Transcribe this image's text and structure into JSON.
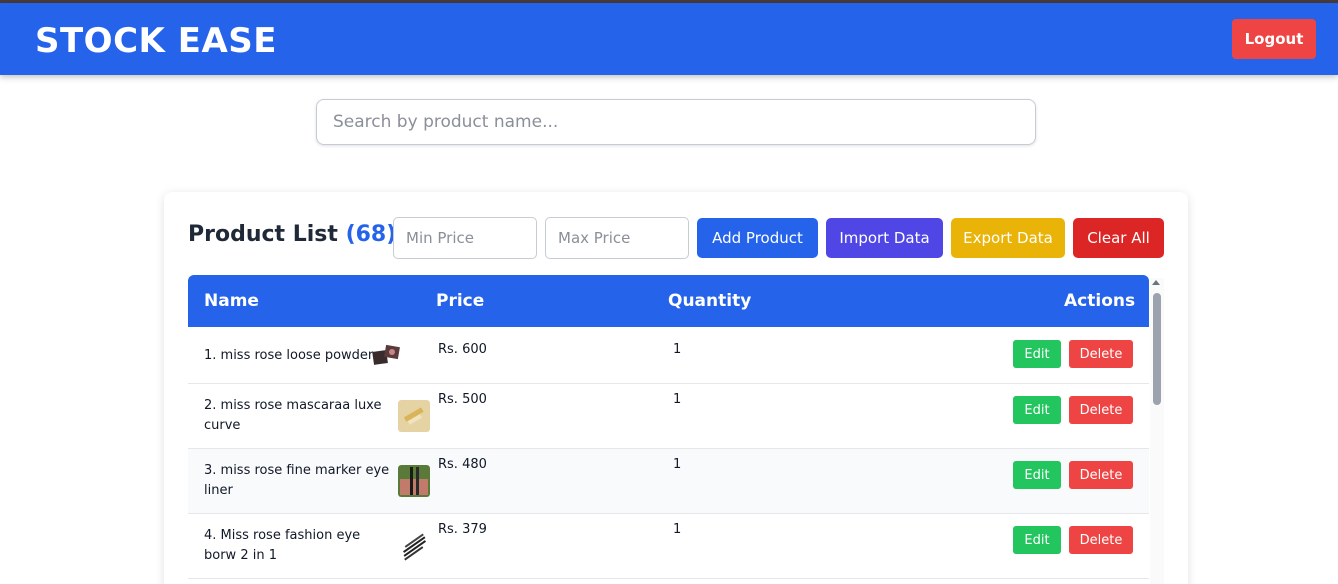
{
  "header": {
    "brand": "STOCK EASE",
    "logout_label": "Logout"
  },
  "search": {
    "placeholder": "Search by product name..."
  },
  "product_list": {
    "title": "Product List",
    "count": "(68)",
    "min_price_placeholder": "Min Price",
    "max_price_placeholder": "Max Price",
    "add_label": "Add Product",
    "import_label": "Import Data",
    "export_label": "Export Data",
    "clear_label": "Clear All"
  },
  "table": {
    "columns": [
      "Name",
      "Price",
      "Quantity",
      "Actions"
    ],
    "rows": [
      {
        "name": "1. miss rose loose powder",
        "price": "Rs. 600",
        "quantity": "1",
        "edit": "Edit",
        "delete": "Delete"
      },
      {
        "name": "2. miss rose mascaraa luxe curve",
        "price": "Rs. 500",
        "quantity": "1",
        "edit": "Edit",
        "delete": "Delete"
      },
      {
        "name": "3. miss rose fine marker eye liner",
        "price": "Rs. 480",
        "quantity": "1",
        "edit": "Edit",
        "delete": "Delete"
      },
      {
        "name": "4. Miss rose fashion eye borw 2 in 1",
        "price": "Rs. 379",
        "quantity": "1",
        "edit": "Edit",
        "delete": "Delete"
      }
    ]
  },
  "colors": {
    "primary": "#2563eb",
    "danger": "#ef4444",
    "success": "#22c55e",
    "import": "#4f46e5",
    "export": "#eab308",
    "clear": "#dc2626"
  }
}
